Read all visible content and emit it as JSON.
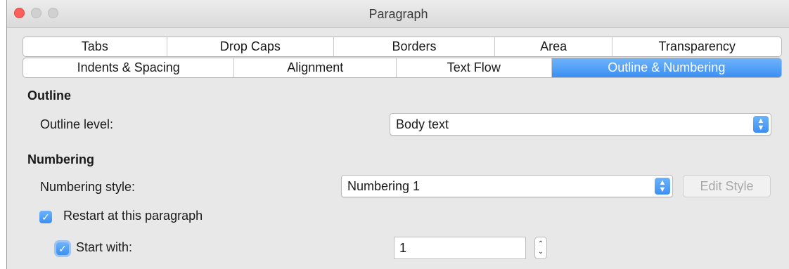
{
  "window": {
    "title": "Paragraph"
  },
  "tabs_row1": [
    "Tabs",
    "Drop Caps",
    "Borders",
    "Area",
    "Transparency"
  ],
  "tabs_row2": [
    "Indents & Spacing",
    "Alignment",
    "Text Flow",
    "Outline & Numbering"
  ],
  "active_tab": "Outline & Numbering",
  "outline": {
    "section_title": "Outline",
    "level_label": "Outline level:",
    "level_value": "Body text"
  },
  "numbering": {
    "section_title": "Numbering",
    "style_label": "Numbering style:",
    "style_value": "Numbering 1",
    "edit_style_label": "Edit Style",
    "restart_label": "Restart at this paragraph",
    "restart_checked": true,
    "start_with_label": "Start with:",
    "start_with_checked": true,
    "start_with_value": "1"
  },
  "colors": {
    "accent": "#3d8ff3",
    "close_button": "#fc605c"
  },
  "icons": {
    "checkmark": "checkmark-icon",
    "select_arrows": "up-down-chevron-icon",
    "spinner": "spinner-arrows-icon"
  }
}
